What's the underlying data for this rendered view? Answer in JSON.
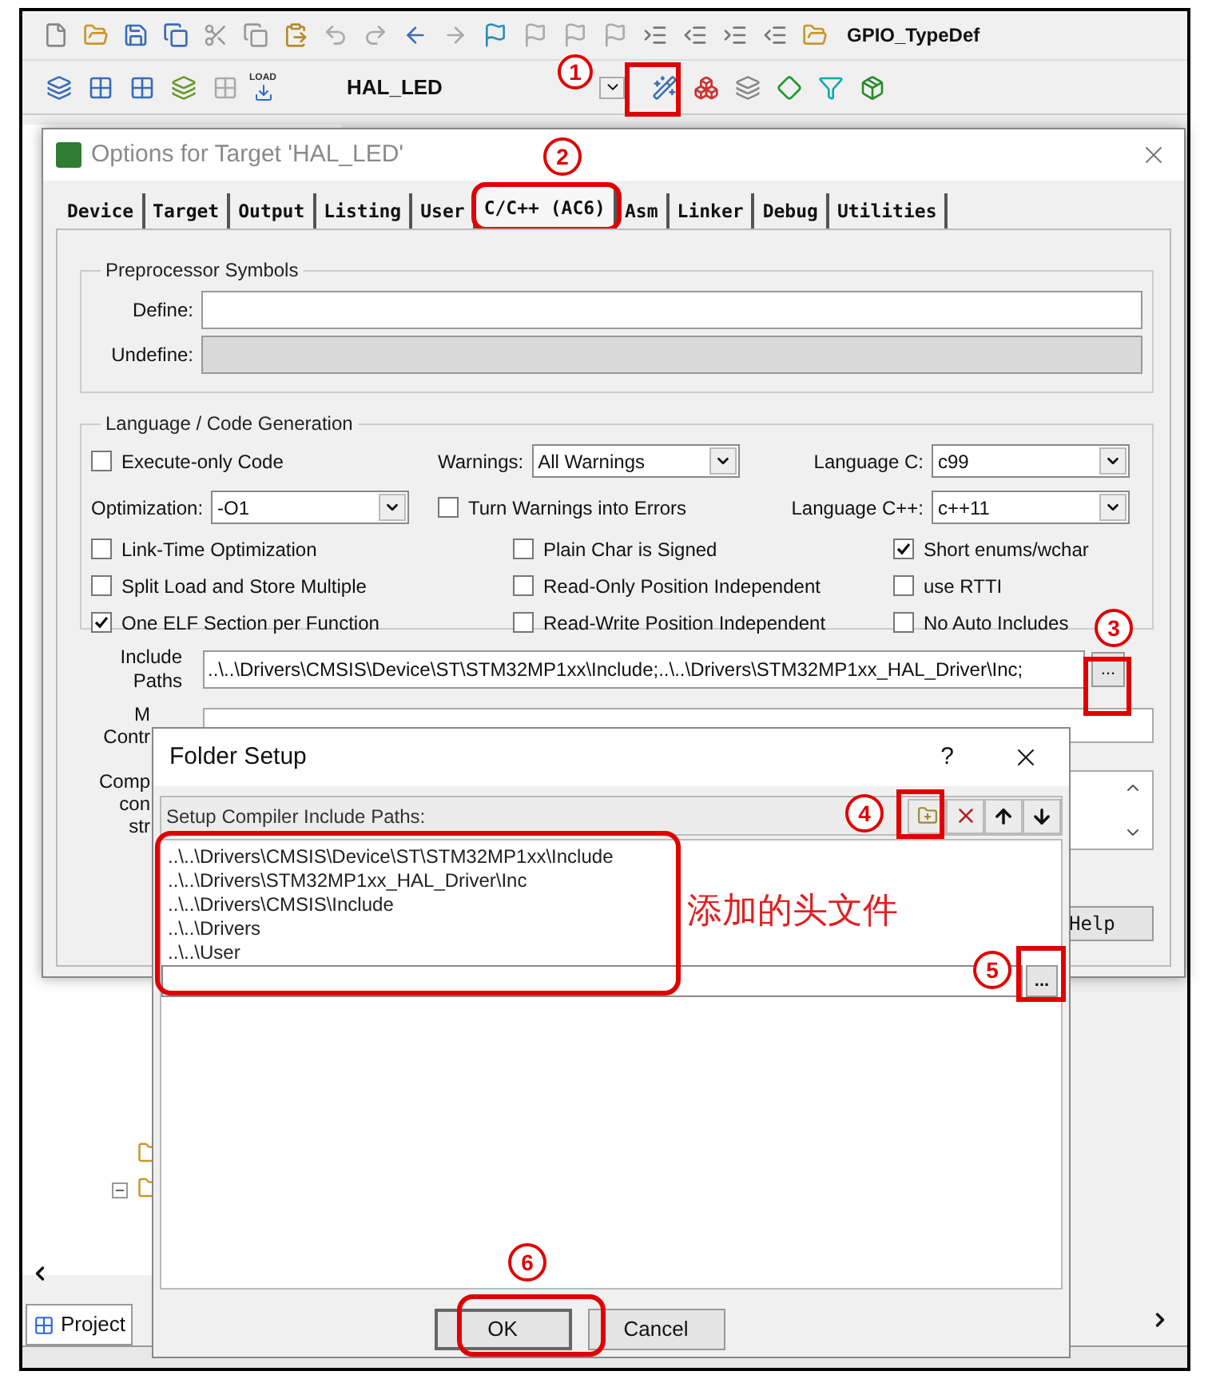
{
  "ide": {
    "toolbar_1": {
      "symbol_field": "GPIO_TypeDef"
    },
    "toolbar_2": {
      "load_label": "LOAD",
      "target_field": "HAL_LED"
    },
    "bottom_tabs": [
      {
        "label": "Project",
        "selected": true
      }
    ]
  },
  "options_dialog": {
    "title": "Options for Target 'HAL_LED'",
    "tabs": [
      {
        "label": "Device",
        "selected": false
      },
      {
        "label": "Target",
        "selected": false
      },
      {
        "label": "Output",
        "selected": false
      },
      {
        "label": "Listing",
        "selected": false
      },
      {
        "label": "User",
        "selected": false
      },
      {
        "label": "C/C++ (AC6)",
        "selected": true
      },
      {
        "label": "Asm",
        "selected": false
      },
      {
        "label": "Linker",
        "selected": false
      },
      {
        "label": "Debug",
        "selected": false
      },
      {
        "label": "Utilities",
        "selected": false
      }
    ],
    "preprocessor": {
      "title": "Preprocessor Symbols",
      "fields": [
        {
          "label": "Define:",
          "disabled": false
        },
        {
          "label": "Undefine:",
          "disabled": true
        }
      ]
    },
    "language": {
      "title": "Language / Code Generation",
      "rows": [
        [
          {
            "kind": "checkbox",
            "label": "Execute-only Code",
            "checked": false
          },
          {
            "kind": "dropdown",
            "label": "Warnings:",
            "value": "All Warnings"
          },
          {
            "kind": "dropdown",
            "label": "Language C:",
            "value": "c99"
          }
        ],
        [
          {
            "kind": "dropdown",
            "label": "Optimization:",
            "value": "-O1"
          },
          {
            "kind": "checkbox",
            "label": "Turn Warnings into Errors",
            "checked": false
          },
          {
            "kind": "dropdown",
            "label": "Language C++:",
            "value": "c++11"
          }
        ],
        [
          {
            "kind": "checkbox",
            "label": "Link-Time Optimization",
            "checked": false
          },
          {
            "kind": "checkbox",
            "label": "Plain Char is Signed",
            "checked": false
          },
          {
            "kind": "checkbox",
            "label": "Short enums/wchar",
            "checked": true
          }
        ],
        [
          {
            "kind": "checkbox",
            "label": "Split Load and Store Multiple",
            "checked": false
          },
          {
            "kind": "checkbox",
            "label": "Read-Only Position Independent",
            "checked": false
          },
          {
            "kind": "checkbox",
            "label": "use RTTI",
            "checked": false
          }
        ],
        [
          {
            "kind": "checkbox",
            "label": "One ELF Section per Function",
            "checked": true
          },
          {
            "kind": "checkbox",
            "label": "Read-Write Position Independent",
            "checked": false
          },
          {
            "kind": "checkbox",
            "label": "No Auto Includes",
            "checked": false
          }
        ]
      ]
    },
    "include_paths": {
      "label": "Include Paths",
      "value": "..\\..\\Drivers\\CMSIS\\Device\\ST\\STM32MP1xx\\Include;..\\..\\Drivers\\STM32MP1xx_HAL_Driver\\Inc;",
      "browse": "..."
    },
    "misc_labels": [
      "M",
      "Contr"
    ],
    "compiler_labels": [
      "Comp",
      "con",
      "str"
    ],
    "help_button": "Help"
  },
  "folder_setup": {
    "title": "Folder Setup",
    "help": "?",
    "list_label": "Setup Compiler Include Paths:",
    "paths": [
      "..\\..\\Drivers\\CMSIS\\Device\\ST\\STM32MP1xx\\Include",
      "..\\..\\Drivers\\STM32MP1xx_HAL_Driver\\Inc",
      "..\\..\\Drivers\\CMSIS\\Include",
      "..\\..\\Drivers",
      "..\\..\\User"
    ],
    "browse": "...",
    "buttons": [
      {
        "label": "OK",
        "kind": "default"
      },
      {
        "label": "Cancel",
        "kind": "normal"
      }
    ]
  },
  "annotations": {
    "steps": [
      "1",
      "2",
      "3",
      "4",
      "5",
      "6"
    ],
    "note": "添加的头文件"
  }
}
